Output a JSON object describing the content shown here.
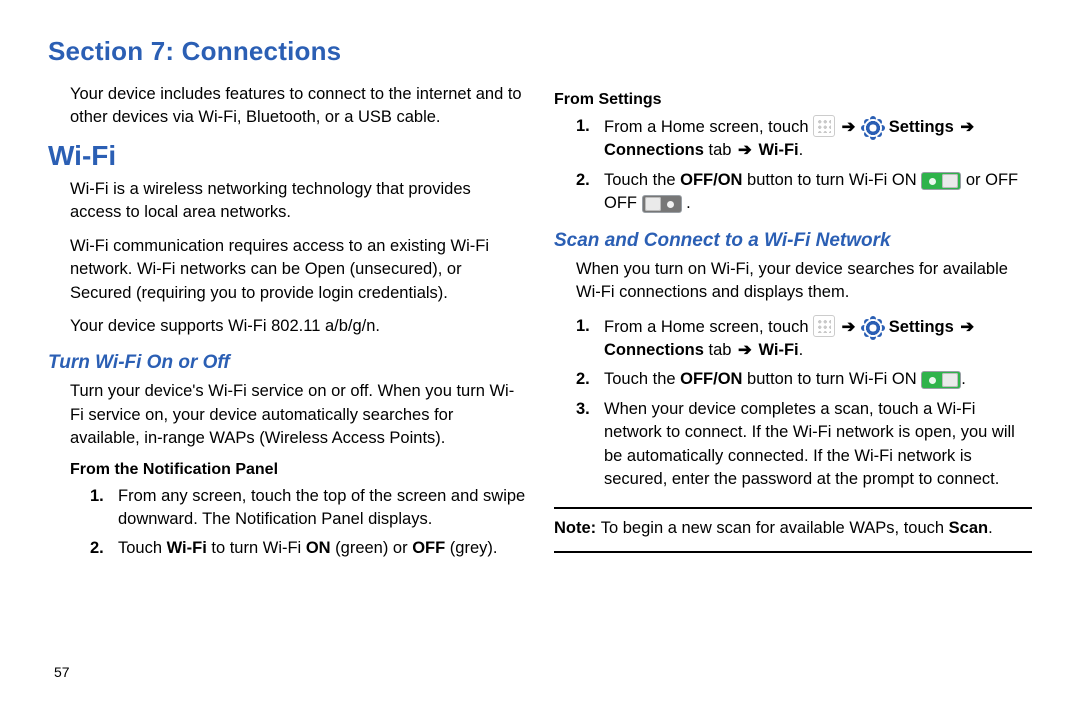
{
  "section": {
    "title": "Section 7: Connections"
  },
  "intro": "Your device includes features to connect to the internet and to other devices via Wi-Fi, Bluetooth, or a USB cable.",
  "wifi": {
    "h2": "Wi-Fi",
    "p1": "Wi-Fi is a wireless networking technology that provides access to local area networks.",
    "p2": "Wi-Fi communication requires access to an existing Wi-Fi network. Wi-Fi networks can be Open (unsecured), or Secured (requiring you to provide login credentials).",
    "p3": "Your device supports Wi-Fi 802.11 a/b/g/n."
  },
  "turn": {
    "h3": "Turn Wi-Fi On or Off",
    "p1": "Turn your device's Wi-Fi service on or off. When you turn Wi-Fi service on, your device automatically searches for available, in-range WAPs (Wireless Access Points).",
    "sub1": "From the Notification Panel",
    "steps1": [
      "From any screen, touch the top of the screen and swipe downward. The Notification Panel displays.",
      "Touch Wi-Fi to turn Wi-Fi ON (green) or OFF (grey)."
    ]
  },
  "right": {
    "sub2": "From Settings",
    "steps2_1_pre": "From a Home screen, touch ",
    "steps2_1_mid": "Settings",
    "steps2_1_line2a": "Connections",
    "steps2_1_line2b": " tab ",
    "steps2_1_line2c": "Wi-Fi",
    "steps2_2_pre": "Touch the ",
    "steps2_2_b": "OFF/ON",
    "steps2_2_mid": " button to turn Wi-Fi ON ",
    "steps2_2_or": " or OFF ",
    "dot": "."
  },
  "scan": {
    "h3": "Scan and Connect to a Wi-Fi Network",
    "p1": "When you turn on Wi-Fi, your device searches for available Wi-Fi connections and displays them.",
    "step1_pre": "From a Home screen, touch ",
    "step1_mid": "Settings",
    "step1_line2a": "Connections",
    "step1_line2b": " tab ",
    "step1_line2c": "Wi-Fi",
    "step2_pre": "Touch the ",
    "step2_b": "OFF/ON",
    "step2_mid": " button to turn Wi-Fi ON ",
    "step3": "When your device completes a scan, touch a Wi-Fi network to connect. If the Wi-Fi network is open, you will be automatically connected. If the Wi-Fi network is secured, enter the password at the prompt to connect."
  },
  "note": {
    "pre": "Note: ",
    "txt": "To begin a new scan for available WAPs, touch ",
    "b": "Scan",
    "dot": "."
  },
  "page_number": "57",
  "glyph": {
    "arrow": "➔"
  }
}
